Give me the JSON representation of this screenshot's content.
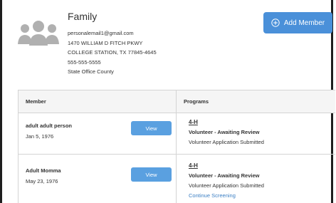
{
  "family": {
    "title": "Family",
    "email": "personalemail1@gmail.com",
    "address1": "1470 WILLIAM D FITCH PKWY",
    "address2": "COLLEGE STATION, TX 77845-4645",
    "phone": "555-555-5555",
    "county": "State Office County",
    "avatar_icon": "family-group-icon"
  },
  "actions": {
    "add_member_label": "Add Member",
    "add_member_icon": "plus-circle-icon"
  },
  "table": {
    "headers": {
      "member": "Member",
      "programs": "Programs"
    },
    "rows": [
      {
        "name": "adult adult person",
        "dob": "Jan 5, 1976",
        "view_label": "View",
        "program": "4-H",
        "status": "Volunteer - Awaiting Review",
        "detail": "Volunteer Application Submitted",
        "link": ""
      },
      {
        "name": "Adult Momma",
        "dob": "May 23, 1976",
        "view_label": "View",
        "program": "4-H",
        "status": "Volunteer - Awaiting Review",
        "detail": "Volunteer Application Submitted",
        "link": "Continue Screening"
      }
    ]
  },
  "colors": {
    "primary": "#4a90d9",
    "view_button": "#5aa0e0",
    "link": "#3b7fc4",
    "avatar": "#b0b0b0"
  }
}
